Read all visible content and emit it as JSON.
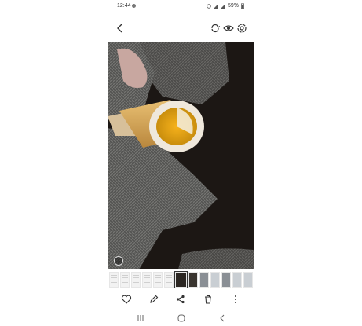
{
  "status": {
    "time": "12:44",
    "battery": "59%"
  },
  "topbar": {
    "icons": [
      "back-icon",
      "rotate-icon",
      "eye-icon",
      "settings-icon"
    ]
  },
  "photo": {
    "subject": "",
    "badge_icon": "remaster-icon"
  },
  "filmstrip": {
    "thumb_count": 13,
    "selected_index": 6
  },
  "actions": {
    "icons": [
      "heart-icon",
      "edit-icon",
      "share-icon",
      "trash-icon",
      "more-icon"
    ]
  },
  "nav": {
    "icons": [
      "recent-apps-icon",
      "home-icon",
      "nav-back-icon"
    ]
  },
  "colors": {
    "background": "#ffffff",
    "icon": "#333333",
    "photo_dark": "#1a1614"
  }
}
